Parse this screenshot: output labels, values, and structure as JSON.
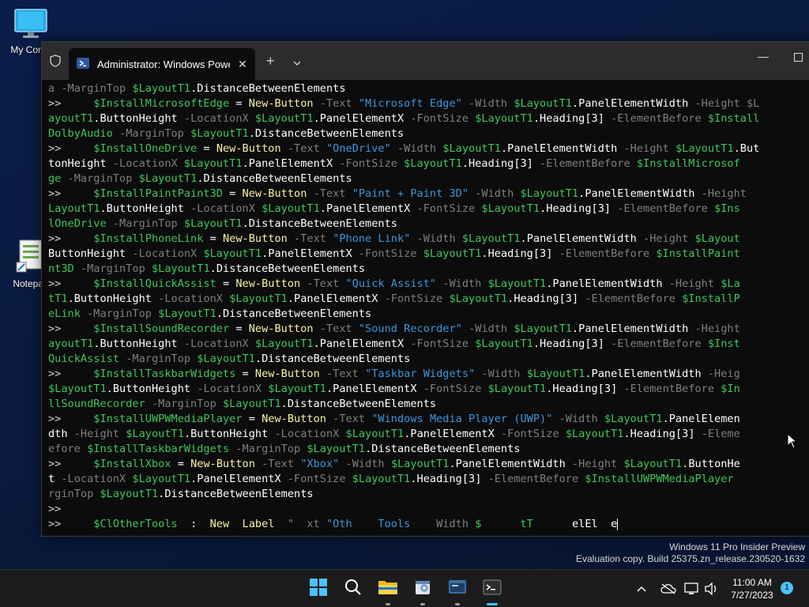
{
  "desktop": {
    "icons": [
      {
        "label": "My Comp"
      },
      {
        "label": "Notepad"
      }
    ]
  },
  "window": {
    "tab_title": "Administrator: Windows Powe",
    "new_tab_label": "+"
  },
  "console": {
    "lines": [
      [
        [
          "p",
          "a -MarginTop "
        ],
        [
          "v",
          "$LayoutT1"
        ],
        [
          "n",
          ".DistanceBetweenElements"
        ]
      ],
      [
        [
          "pr",
          ">>     "
        ],
        [
          "v",
          "$InstallMicrosoftEdge"
        ],
        [
          "n",
          " = "
        ],
        [
          "c",
          "New-Button"
        ],
        [
          "p",
          " -Text "
        ],
        [
          "s",
          "\"Microsoft Edge\""
        ],
        [
          "p",
          " -Width "
        ],
        [
          "v",
          "$LayoutT1"
        ],
        [
          "n",
          ".PanelElementWidth"
        ],
        [
          "p",
          " -Height $L"
        ]
      ],
      [
        [
          "v",
          "ayoutT1"
        ],
        [
          "n",
          ".ButtonHeight"
        ],
        [
          "p",
          " -LocationX "
        ],
        [
          "v",
          "$LayoutT1"
        ],
        [
          "n",
          ".PanelElementX"
        ],
        [
          "p",
          " -FontSize "
        ],
        [
          "v",
          "$LayoutT1"
        ],
        [
          "n",
          ".Heading[3]"
        ],
        [
          "p",
          " -ElementBefore "
        ],
        [
          "v",
          "$Install"
        ]
      ],
      [
        [
          "v",
          "DolbyAudio"
        ],
        [
          "p",
          " -MarginTop "
        ],
        [
          "v",
          "$LayoutT1"
        ],
        [
          "n",
          ".DistanceBetweenElements"
        ]
      ],
      [
        [
          "pr",
          ">>     "
        ],
        [
          "v",
          "$InstallOneDrive"
        ],
        [
          "n",
          " = "
        ],
        [
          "c",
          "New-Button"
        ],
        [
          "p",
          " -Text "
        ],
        [
          "s",
          "\"OneDrive\""
        ],
        [
          "p",
          " -Width "
        ],
        [
          "v",
          "$LayoutT1"
        ],
        [
          "n",
          ".PanelElementWidth"
        ],
        [
          "p",
          " -Height "
        ],
        [
          "v",
          "$LayoutT1"
        ],
        [
          "n",
          ".But"
        ]
      ],
      [
        [
          "n",
          "tonHeight"
        ],
        [
          "p",
          " -LocationX "
        ],
        [
          "v",
          "$LayoutT1"
        ],
        [
          "n",
          ".PanelElementX"
        ],
        [
          "p",
          " -FontSize "
        ],
        [
          "v",
          "$LayoutT1"
        ],
        [
          "n",
          ".Heading[3]"
        ],
        [
          "p",
          " -ElementBefore "
        ],
        [
          "v",
          "$InstallMicrosof"
        ]
      ],
      [
        [
          "v",
          "ge"
        ],
        [
          "p",
          " -MarginTop "
        ],
        [
          "v",
          "$LayoutT1"
        ],
        [
          "n",
          ".DistanceBetweenElements"
        ]
      ],
      [
        [
          "pr",
          ">>     "
        ],
        [
          "v",
          "$InstallPaintPaint3D"
        ],
        [
          "n",
          " = "
        ],
        [
          "c",
          "New-Button"
        ],
        [
          "p",
          " -Text "
        ],
        [
          "s",
          "\"Paint + Paint 3D\""
        ],
        [
          "p",
          " -Width "
        ],
        [
          "v",
          "$LayoutT1"
        ],
        [
          "n",
          ".PanelElementWidth"
        ],
        [
          "p",
          " -Height"
        ]
      ],
      [
        [
          "v",
          "LayoutT1"
        ],
        [
          "n",
          ".ButtonHeight"
        ],
        [
          "p",
          " -LocationX "
        ],
        [
          "v",
          "$LayoutT1"
        ],
        [
          "n",
          ".PanelElementX"
        ],
        [
          "p",
          " -FontSize "
        ],
        [
          "v",
          "$LayoutT1"
        ],
        [
          "n",
          ".Heading[3]"
        ],
        [
          "p",
          " -ElementBefore "
        ],
        [
          "v",
          "$Ins"
        ]
      ],
      [
        [
          "v",
          "lOneDrive"
        ],
        [
          "p",
          " -MarginTop "
        ],
        [
          "v",
          "$LayoutT1"
        ],
        [
          "n",
          ".DistanceBetweenElements"
        ]
      ],
      [
        [
          "pr",
          ">>     "
        ],
        [
          "v",
          "$InstallPhoneLink"
        ],
        [
          "n",
          " = "
        ],
        [
          "c",
          "New-Button"
        ],
        [
          "p",
          " -Text "
        ],
        [
          "s",
          "\"Phone Link\""
        ],
        [
          "p",
          " -Width "
        ],
        [
          "v",
          "$LayoutT1"
        ],
        [
          "n",
          ".PanelElementWidth"
        ],
        [
          "p",
          " -Height "
        ],
        [
          "v",
          "$Layout"
        ]
      ],
      [
        [
          "n",
          "ButtonHeight"
        ],
        [
          "p",
          " -LocationX "
        ],
        [
          "v",
          "$LayoutT1"
        ],
        [
          "n",
          ".PanelElementX"
        ],
        [
          "p",
          " -FontSize "
        ],
        [
          "v",
          "$LayoutT1"
        ],
        [
          "n",
          ".Heading[3]"
        ],
        [
          "p",
          " -ElementBefore "
        ],
        [
          "v",
          "$InstallPaint"
        ]
      ],
      [
        [
          "v",
          "nt3D"
        ],
        [
          "p",
          " -MarginTop "
        ],
        [
          "v",
          "$LayoutT1"
        ],
        [
          "n",
          ".DistanceBetweenElements"
        ]
      ],
      [
        [
          "pr",
          ">>     "
        ],
        [
          "v",
          "$InstallQuickAssist"
        ],
        [
          "n",
          " = "
        ],
        [
          "c",
          "New-Button"
        ],
        [
          "p",
          " -Text "
        ],
        [
          "s",
          "\"Quick Assist\""
        ],
        [
          "p",
          " -Width "
        ],
        [
          "v",
          "$LayoutT1"
        ],
        [
          "n",
          ".PanelElementWidth"
        ],
        [
          "p",
          " -Height "
        ],
        [
          "v",
          "$La"
        ]
      ],
      [
        [
          "v",
          "tT1"
        ],
        [
          "n",
          ".ButtonHeight"
        ],
        [
          "p",
          " -LocationX "
        ],
        [
          "v",
          "$LayoutT1"
        ],
        [
          "n",
          ".PanelElementX"
        ],
        [
          "p",
          " -FontSize "
        ],
        [
          "v",
          "$LayoutT1"
        ],
        [
          "n",
          ".Heading[3]"
        ],
        [
          "p",
          " -ElementBefore "
        ],
        [
          "v",
          "$InstallP"
        ]
      ],
      [
        [
          "v",
          "eLink"
        ],
        [
          "p",
          " -MarginTop "
        ],
        [
          "v",
          "$LayoutT1"
        ],
        [
          "n",
          ".DistanceBetweenElements"
        ]
      ],
      [
        [
          "pr",
          ">>     "
        ],
        [
          "v",
          "$InstallSoundRecorder"
        ],
        [
          "n",
          " = "
        ],
        [
          "c",
          "New-Button"
        ],
        [
          "p",
          " -Text "
        ],
        [
          "s",
          "\"Sound Recorder\""
        ],
        [
          "p",
          " -Width "
        ],
        [
          "v",
          "$LayoutT1"
        ],
        [
          "n",
          ".PanelElementWidth"
        ],
        [
          "p",
          " -Height"
        ]
      ],
      [
        [
          "v",
          "ayoutT1"
        ],
        [
          "n",
          ".ButtonHeight"
        ],
        [
          "p",
          " -LocationX "
        ],
        [
          "v",
          "$LayoutT1"
        ],
        [
          "n",
          ".PanelElementX"
        ],
        [
          "p",
          " -FontSize "
        ],
        [
          "v",
          "$LayoutT1"
        ],
        [
          "n",
          ".Heading[3]"
        ],
        [
          "p",
          " -ElementBefore "
        ],
        [
          "v",
          "$Inst"
        ]
      ],
      [
        [
          "v",
          "QuickAssist"
        ],
        [
          "p",
          " -MarginTop "
        ],
        [
          "v",
          "$LayoutT1"
        ],
        [
          "n",
          ".DistanceBetweenElements"
        ]
      ],
      [
        [
          "pr",
          ">>     "
        ],
        [
          "v",
          "$InstallTaskbarWidgets"
        ],
        [
          "n",
          " = "
        ],
        [
          "c",
          "New-Button"
        ],
        [
          "p",
          " -Text "
        ],
        [
          "s",
          "\"Taskbar Widgets\""
        ],
        [
          "p",
          " -Width "
        ],
        [
          "v",
          "$LayoutT1"
        ],
        [
          "n",
          ".PanelElementWidth"
        ],
        [
          "p",
          " -Heig"
        ]
      ],
      [
        [
          "v",
          "$LayoutT1"
        ],
        [
          "n",
          ".ButtonHeight"
        ],
        [
          "p",
          " -LocationX "
        ],
        [
          "v",
          "$LayoutT1"
        ],
        [
          "n",
          ".PanelElementX"
        ],
        [
          "p",
          " -FontSize "
        ],
        [
          "v",
          "$LayoutT1"
        ],
        [
          "n",
          ".Heading[3]"
        ],
        [
          "p",
          " -ElementBefore "
        ],
        [
          "v",
          "$In"
        ]
      ],
      [
        [
          "v",
          "llSoundRecorder"
        ],
        [
          "p",
          " -MarginTop "
        ],
        [
          "v",
          "$LayoutT1"
        ],
        [
          "n",
          ".DistanceBetweenElements"
        ]
      ],
      [
        [
          "pr",
          ">>     "
        ],
        [
          "v",
          "$InstallUWPWMediaPlayer"
        ],
        [
          "n",
          " = "
        ],
        [
          "c",
          "New-Button"
        ],
        [
          "p",
          " -Text "
        ],
        [
          "s",
          "\"Windows Media Player (UWP)\""
        ],
        [
          "p",
          " -Width "
        ],
        [
          "v",
          "$LayoutT1"
        ],
        [
          "n",
          ".PanelElemen"
        ]
      ],
      [
        [
          "n",
          "dth"
        ],
        [
          "p",
          " -Height "
        ],
        [
          "v",
          "$LayoutT1"
        ],
        [
          "n",
          ".ButtonHeight"
        ],
        [
          "p",
          " -LocationX "
        ],
        [
          "v",
          "$LayoutT1"
        ],
        [
          "n",
          ".PanelElementX"
        ],
        [
          "p",
          " -FontSize "
        ],
        [
          "v",
          "$LayoutT1"
        ],
        [
          "n",
          ".Heading[3]"
        ],
        [
          "p",
          " -Eleme"
        ]
      ],
      [
        [
          "p",
          "efore "
        ],
        [
          "v",
          "$InstallTaskbarWidgets"
        ],
        [
          "p",
          " -MarginTop "
        ],
        [
          "v",
          "$LayoutT1"
        ],
        [
          "n",
          ".DistanceBetweenElements"
        ]
      ],
      [
        [
          "pr",
          ">>     "
        ],
        [
          "v",
          "$InstallXbox"
        ],
        [
          "n",
          " = "
        ],
        [
          "c",
          "New-Button"
        ],
        [
          "p",
          " -Text "
        ],
        [
          "s",
          "\"Xbox\""
        ],
        [
          "p",
          " -Width "
        ],
        [
          "v",
          "$LayoutT1"
        ],
        [
          "n",
          ".PanelElementWidth"
        ],
        [
          "p",
          " -Height "
        ],
        [
          "v",
          "$LayoutT1"
        ],
        [
          "n",
          ".ButtonHe"
        ]
      ],
      [
        [
          "n",
          "t"
        ],
        [
          "p",
          " -LocationX "
        ],
        [
          "v",
          "$LayoutT1"
        ],
        [
          "n",
          ".PanelElementX"
        ],
        [
          "p",
          " -FontSize "
        ],
        [
          "v",
          "$LayoutT1"
        ],
        [
          "n",
          ".Heading[3]"
        ],
        [
          "p",
          " -ElementBefore "
        ],
        [
          "v",
          "$InstallUWPWMediaPlayer"
        ]
      ],
      [
        [
          "p",
          "rginTop "
        ],
        [
          "v",
          "$LayoutT1"
        ],
        [
          "n",
          ".DistanceBetweenElements"
        ]
      ],
      [
        [
          "pr",
          ">>"
        ]
      ],
      [
        [
          "pr",
          ">>     "
        ],
        [
          "v",
          "$ClOtherTools"
        ],
        [
          "n",
          "  :  "
        ],
        [
          "c",
          "New  Label"
        ],
        [
          "p",
          "  \"  xt "
        ],
        [
          "s",
          "\"Oth    Tools  "
        ],
        [
          "p",
          "  Width "
        ],
        [
          "v",
          "$      tT      "
        ],
        [
          "n",
          "elEl  e"
        ]
      ]
    ]
  },
  "watermark": {
    "line1": "Windows 11 Pro Insider Preview",
    "line2": "Evaluation copy. Build 25375.zn_release.230520-1632"
  },
  "taskbar": {
    "time": "11:00 AM",
    "date": "7/27/2023",
    "notification_count": "1"
  },
  "colors": {
    "variable": "#3ec65a",
    "command": "#f9f1a5",
    "parameter": "#7f7f7f",
    "string": "#3a96dd",
    "accent": "#4cc2ff"
  }
}
